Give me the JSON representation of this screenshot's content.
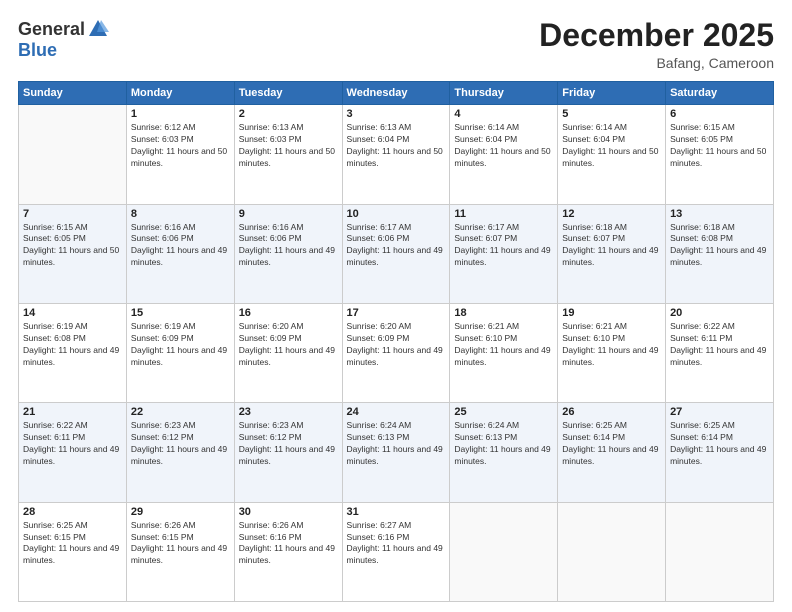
{
  "header": {
    "logo_general": "General",
    "logo_blue": "Blue",
    "month": "December 2025",
    "location": "Bafang, Cameroon"
  },
  "days_of_week": [
    "Sunday",
    "Monday",
    "Tuesday",
    "Wednesday",
    "Thursday",
    "Friday",
    "Saturday"
  ],
  "weeks": [
    [
      {
        "day": "",
        "sunrise": "",
        "sunset": "",
        "daylight": ""
      },
      {
        "day": "1",
        "sunrise": "Sunrise: 6:12 AM",
        "sunset": "Sunset: 6:03 PM",
        "daylight": "Daylight: 11 hours and 50 minutes."
      },
      {
        "day": "2",
        "sunrise": "Sunrise: 6:13 AM",
        "sunset": "Sunset: 6:03 PM",
        "daylight": "Daylight: 11 hours and 50 minutes."
      },
      {
        "day": "3",
        "sunrise": "Sunrise: 6:13 AM",
        "sunset": "Sunset: 6:04 PM",
        "daylight": "Daylight: 11 hours and 50 minutes."
      },
      {
        "day": "4",
        "sunrise": "Sunrise: 6:14 AM",
        "sunset": "Sunset: 6:04 PM",
        "daylight": "Daylight: 11 hours and 50 minutes."
      },
      {
        "day": "5",
        "sunrise": "Sunrise: 6:14 AM",
        "sunset": "Sunset: 6:04 PM",
        "daylight": "Daylight: 11 hours and 50 minutes."
      },
      {
        "day": "6",
        "sunrise": "Sunrise: 6:15 AM",
        "sunset": "Sunset: 6:05 PM",
        "daylight": "Daylight: 11 hours and 50 minutes."
      }
    ],
    [
      {
        "day": "7",
        "sunrise": "Sunrise: 6:15 AM",
        "sunset": "Sunset: 6:05 PM",
        "daylight": "Daylight: 11 hours and 50 minutes."
      },
      {
        "day": "8",
        "sunrise": "Sunrise: 6:16 AM",
        "sunset": "Sunset: 6:06 PM",
        "daylight": "Daylight: 11 hours and 49 minutes."
      },
      {
        "day": "9",
        "sunrise": "Sunrise: 6:16 AM",
        "sunset": "Sunset: 6:06 PM",
        "daylight": "Daylight: 11 hours and 49 minutes."
      },
      {
        "day": "10",
        "sunrise": "Sunrise: 6:17 AM",
        "sunset": "Sunset: 6:06 PM",
        "daylight": "Daylight: 11 hours and 49 minutes."
      },
      {
        "day": "11",
        "sunrise": "Sunrise: 6:17 AM",
        "sunset": "Sunset: 6:07 PM",
        "daylight": "Daylight: 11 hours and 49 minutes."
      },
      {
        "day": "12",
        "sunrise": "Sunrise: 6:18 AM",
        "sunset": "Sunset: 6:07 PM",
        "daylight": "Daylight: 11 hours and 49 minutes."
      },
      {
        "day": "13",
        "sunrise": "Sunrise: 6:18 AM",
        "sunset": "Sunset: 6:08 PM",
        "daylight": "Daylight: 11 hours and 49 minutes."
      }
    ],
    [
      {
        "day": "14",
        "sunrise": "Sunrise: 6:19 AM",
        "sunset": "Sunset: 6:08 PM",
        "daylight": "Daylight: 11 hours and 49 minutes."
      },
      {
        "day": "15",
        "sunrise": "Sunrise: 6:19 AM",
        "sunset": "Sunset: 6:09 PM",
        "daylight": "Daylight: 11 hours and 49 minutes."
      },
      {
        "day": "16",
        "sunrise": "Sunrise: 6:20 AM",
        "sunset": "Sunset: 6:09 PM",
        "daylight": "Daylight: 11 hours and 49 minutes."
      },
      {
        "day": "17",
        "sunrise": "Sunrise: 6:20 AM",
        "sunset": "Sunset: 6:09 PM",
        "daylight": "Daylight: 11 hours and 49 minutes."
      },
      {
        "day": "18",
        "sunrise": "Sunrise: 6:21 AM",
        "sunset": "Sunset: 6:10 PM",
        "daylight": "Daylight: 11 hours and 49 minutes."
      },
      {
        "day": "19",
        "sunrise": "Sunrise: 6:21 AM",
        "sunset": "Sunset: 6:10 PM",
        "daylight": "Daylight: 11 hours and 49 minutes."
      },
      {
        "day": "20",
        "sunrise": "Sunrise: 6:22 AM",
        "sunset": "Sunset: 6:11 PM",
        "daylight": "Daylight: 11 hours and 49 minutes."
      }
    ],
    [
      {
        "day": "21",
        "sunrise": "Sunrise: 6:22 AM",
        "sunset": "Sunset: 6:11 PM",
        "daylight": "Daylight: 11 hours and 49 minutes."
      },
      {
        "day": "22",
        "sunrise": "Sunrise: 6:23 AM",
        "sunset": "Sunset: 6:12 PM",
        "daylight": "Daylight: 11 hours and 49 minutes."
      },
      {
        "day": "23",
        "sunrise": "Sunrise: 6:23 AM",
        "sunset": "Sunset: 6:12 PM",
        "daylight": "Daylight: 11 hours and 49 minutes."
      },
      {
        "day": "24",
        "sunrise": "Sunrise: 6:24 AM",
        "sunset": "Sunset: 6:13 PM",
        "daylight": "Daylight: 11 hours and 49 minutes."
      },
      {
        "day": "25",
        "sunrise": "Sunrise: 6:24 AM",
        "sunset": "Sunset: 6:13 PM",
        "daylight": "Daylight: 11 hours and 49 minutes."
      },
      {
        "day": "26",
        "sunrise": "Sunrise: 6:25 AM",
        "sunset": "Sunset: 6:14 PM",
        "daylight": "Daylight: 11 hours and 49 minutes."
      },
      {
        "day": "27",
        "sunrise": "Sunrise: 6:25 AM",
        "sunset": "Sunset: 6:14 PM",
        "daylight": "Daylight: 11 hours and 49 minutes."
      }
    ],
    [
      {
        "day": "28",
        "sunrise": "Sunrise: 6:25 AM",
        "sunset": "Sunset: 6:15 PM",
        "daylight": "Daylight: 11 hours and 49 minutes."
      },
      {
        "day": "29",
        "sunrise": "Sunrise: 6:26 AM",
        "sunset": "Sunset: 6:15 PM",
        "daylight": "Daylight: 11 hours and 49 minutes."
      },
      {
        "day": "30",
        "sunrise": "Sunrise: 6:26 AM",
        "sunset": "Sunset: 6:16 PM",
        "daylight": "Daylight: 11 hours and 49 minutes."
      },
      {
        "day": "31",
        "sunrise": "Sunrise: 6:27 AM",
        "sunset": "Sunset: 6:16 PM",
        "daylight": "Daylight: 11 hours and 49 minutes."
      },
      {
        "day": "",
        "sunrise": "",
        "sunset": "",
        "daylight": ""
      },
      {
        "day": "",
        "sunrise": "",
        "sunset": "",
        "daylight": ""
      },
      {
        "day": "",
        "sunrise": "",
        "sunset": "",
        "daylight": ""
      }
    ]
  ]
}
